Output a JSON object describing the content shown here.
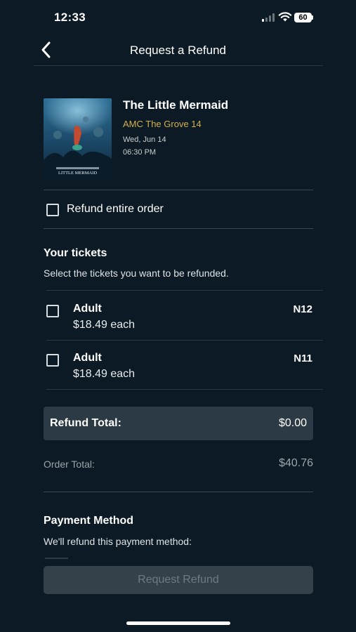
{
  "status_bar": {
    "time": "12:33",
    "battery": "60",
    "icons": [
      "cellular-signal-icon",
      "wifi-icon",
      "battery-icon"
    ]
  },
  "header": {
    "title": "Request a Refund",
    "back_icon": "chevron-left-icon"
  },
  "movie": {
    "title": "The Little Mermaid",
    "theater": "AMC The Grove 14",
    "date": "Wed, Jun 14",
    "time": "06:30 PM",
    "poster_text": "LITTLE MERMAID"
  },
  "refund_entire": {
    "label": "Refund entire order",
    "checked": false
  },
  "tickets_section": {
    "title": "Your tickets",
    "subtitle": "Select the tickets you want to be refunded.",
    "tickets": [
      {
        "type": "Adult",
        "price": "$18.49 each",
        "seat": "N12",
        "checked": false
      },
      {
        "type": "Adult",
        "price": "$18.49 each",
        "seat": "N11",
        "checked": false
      }
    ]
  },
  "totals": {
    "refund_label": "Refund Total:",
    "refund_value": "$0.00",
    "order_label": "Order Total:",
    "order_value": "$40.76"
  },
  "payment": {
    "title": "Payment Method",
    "subtitle": "We'll refund this payment method:"
  },
  "actions": {
    "request_label": "Request Refund"
  },
  "colors": {
    "background": "#0b1a24",
    "accent_gold": "#d4b050",
    "disabled_button": "#34414b"
  }
}
